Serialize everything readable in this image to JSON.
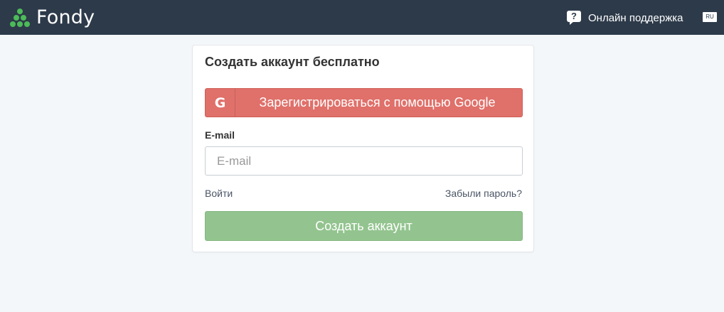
{
  "header": {
    "logo_text": "Fondy",
    "support_icon_glyph": "?",
    "support_label": "Онлайн поддержка",
    "language": "RU",
    "brand_color": "#4cbb58",
    "bar_color": "#2d3a4a"
  },
  "card": {
    "title": "Создать аккаунт бесплатно",
    "google_button": {
      "icon": "G",
      "label": "Зарегистрироваться с помощью Google",
      "color": "#e0706a"
    },
    "email": {
      "label": "E-mail",
      "placeholder": "E-mail",
      "value": ""
    },
    "login_link": "Войти",
    "forgot_link": "Забыли пароль?",
    "create_button": {
      "label": "Создать аккаунт",
      "color": "#93c48f"
    }
  }
}
